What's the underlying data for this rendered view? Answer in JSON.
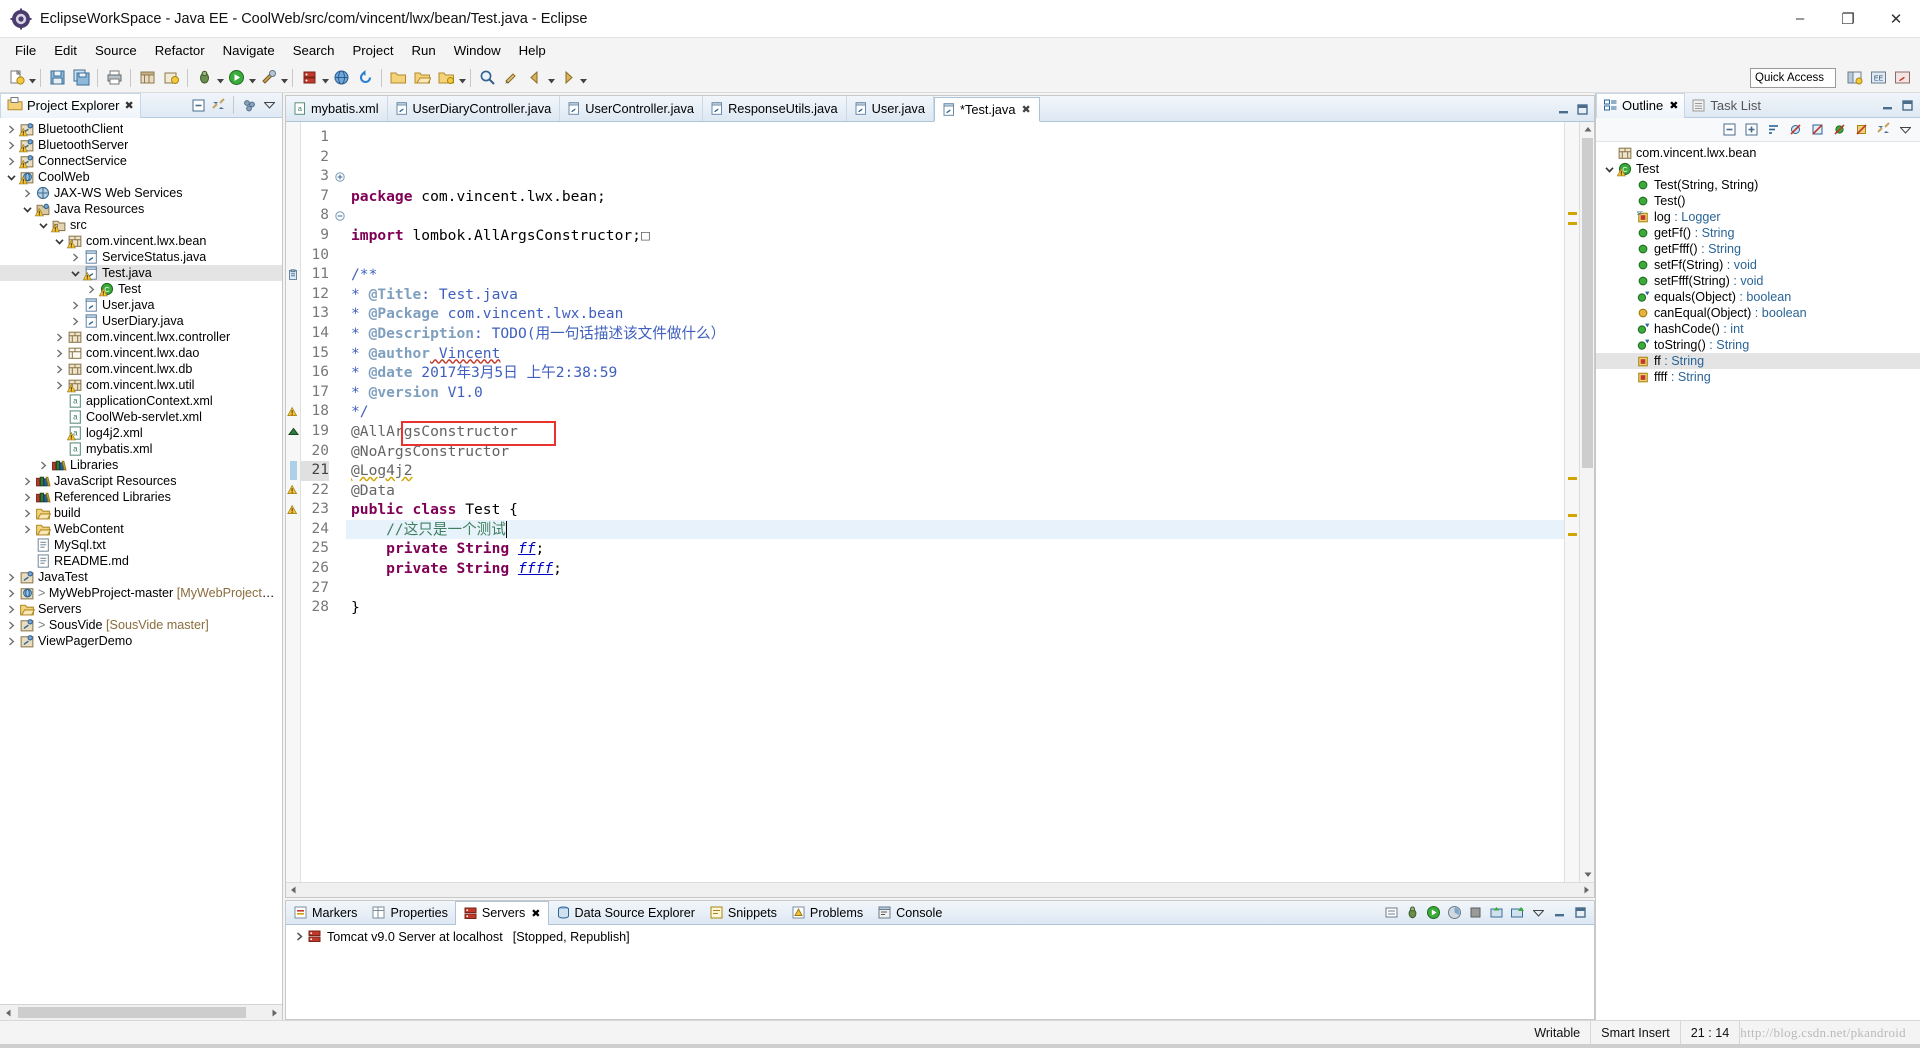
{
  "window": {
    "title": "EclipseWorkSpace - Java EE - CoolWeb/src/com/vincent/lwx/bean/Test.java - Eclipse",
    "icon": "eclipse-icon",
    "minimize": "–",
    "maximize": "❐",
    "close": "✕"
  },
  "menubar": {
    "items": [
      "File",
      "Edit",
      "Source",
      "Refactor",
      "Navigate",
      "Search",
      "Project",
      "Run",
      "Window",
      "Help"
    ]
  },
  "toolbar": {
    "quick_access_placeholder": "Quick Access"
  },
  "project_explorer": {
    "tab_label": "Project Explorer",
    "close_glyph": "✖",
    "tree": [
      {
        "label": "BluetoothClient",
        "indent": 0,
        "twist": "collapsed",
        "icon": "java-project-icon",
        "warn": true
      },
      {
        "label": "BluetoothServer",
        "indent": 0,
        "twist": "collapsed",
        "icon": "java-project-icon",
        "warn": true
      },
      {
        "label": "ConnectService",
        "indent": 0,
        "twist": "collapsed",
        "icon": "java-project-icon",
        "warn": true
      },
      {
        "label": "CoolWeb",
        "indent": 0,
        "twist": "expanded",
        "icon": "web-project-icon",
        "warn": true
      },
      {
        "label": "JAX-WS Web Services",
        "indent": 1,
        "twist": "collapsed",
        "icon": "jaxws-icon",
        "warn": false
      },
      {
        "label": "Java Resources",
        "indent": 1,
        "twist": "expanded",
        "icon": "java-resources-icon",
        "warn": true
      },
      {
        "label": "src",
        "indent": 2,
        "twist": "expanded",
        "icon": "source-folder-icon",
        "warn": true
      },
      {
        "label": "com.vincent.lwx.bean",
        "indent": 3,
        "twist": "expanded",
        "icon": "package-icon",
        "warn": true
      },
      {
        "label": "ServiceStatus.java",
        "indent": 4,
        "twist": "collapsed",
        "icon": "java-file-icon",
        "warn": false
      },
      {
        "label": "Test.java",
        "indent": 4,
        "twist": "expanded",
        "icon": "java-file-icon",
        "warn": true,
        "selected": true
      },
      {
        "label": "Test",
        "indent": 5,
        "twist": "collapsed",
        "icon": "class-icon",
        "warn": true
      },
      {
        "label": "User.java",
        "indent": 4,
        "twist": "collapsed",
        "icon": "java-file-icon",
        "warn": false
      },
      {
        "label": "UserDiary.java",
        "indent": 4,
        "twist": "collapsed",
        "icon": "java-file-icon",
        "warn": false
      },
      {
        "label": "com.vincent.lwx.controller",
        "indent": 3,
        "twist": "collapsed",
        "icon": "package-icon",
        "warn": false
      },
      {
        "label": "com.vincent.lwx.dao",
        "indent": 3,
        "twist": "collapsed",
        "icon": "package-empty-icon",
        "warn": false
      },
      {
        "label": "com.vincent.lwx.db",
        "indent": 3,
        "twist": "collapsed",
        "icon": "package-icon",
        "warn": false
      },
      {
        "label": "com.vincent.lwx.util",
        "indent": 3,
        "twist": "collapsed",
        "icon": "package-icon",
        "warn": true
      },
      {
        "label": "applicationContext.xml",
        "indent": 3,
        "twist": "none",
        "icon": "xml-file-icon",
        "warn": false
      },
      {
        "label": "CoolWeb-servlet.xml",
        "indent": 3,
        "twist": "none",
        "icon": "xml-file-icon",
        "warn": false
      },
      {
        "label": "log4j2.xml",
        "indent": 3,
        "twist": "none",
        "icon": "xml-file-icon",
        "warn": true
      },
      {
        "label": "mybatis.xml",
        "indent": 3,
        "twist": "none",
        "icon": "xml-file-icon",
        "warn": false
      },
      {
        "label": "Libraries",
        "indent": 2,
        "twist": "collapsed",
        "icon": "library-icon",
        "warn": false
      },
      {
        "label": "JavaScript Resources",
        "indent": 1,
        "twist": "collapsed",
        "icon": "library-icon",
        "warn": false
      },
      {
        "label": "Referenced Libraries",
        "indent": 1,
        "twist": "collapsed",
        "icon": "library-icon",
        "warn": false
      },
      {
        "label": "build",
        "indent": 1,
        "twist": "collapsed",
        "icon": "folder-icon",
        "warn": false
      },
      {
        "label": "WebContent",
        "indent": 1,
        "twist": "collapsed",
        "icon": "folder-icon",
        "warn": false
      },
      {
        "label": "MySql.txt",
        "indent": 1,
        "twist": "none",
        "icon": "text-file-icon",
        "warn": false
      },
      {
        "label": "README.md",
        "indent": 1,
        "twist": "none",
        "icon": "text-file-icon",
        "warn": false
      },
      {
        "label": "JavaTest",
        "indent": 0,
        "twist": "collapsed",
        "icon": "java-project-icon",
        "warn": false
      },
      {
        "label": "MyWebProject-master",
        "indent": 0,
        "twist": "collapsed",
        "icon": "web-project-icon",
        "warn": false,
        "decoration": "[MyWebProject-master m",
        "closed": true
      },
      {
        "label": "Servers",
        "indent": 0,
        "twist": "collapsed",
        "icon": "folder-icon",
        "warn": false
      },
      {
        "label": "SousVide",
        "indent": 0,
        "twist": "collapsed",
        "icon": "java-project-icon",
        "warn": false,
        "decoration": "[SousVide master]",
        "closed": true
      },
      {
        "label": "ViewPagerDemo",
        "indent": 0,
        "twist": "collapsed",
        "icon": "java-project-icon",
        "warn": false
      }
    ]
  },
  "editor": {
    "tabs": [
      {
        "label": "mybatis.xml",
        "icon": "xml-file-icon",
        "active": false,
        "dirty": false
      },
      {
        "label": "UserDiaryController.java",
        "icon": "java-file-icon",
        "active": false,
        "dirty": false
      },
      {
        "label": "UserController.java",
        "icon": "java-file-icon",
        "active": false,
        "dirty": false
      },
      {
        "label": "ResponseUtils.java",
        "icon": "java-file-icon",
        "active": false,
        "dirty": false
      },
      {
        "label": "User.java",
        "icon": "java-file-icon",
        "active": false,
        "dirty": false
      },
      {
        "label": "*Test.java",
        "icon": "java-file-icon",
        "active": true,
        "dirty": true
      }
    ],
    "lines": [
      {
        "num": "1",
        "marker": "",
        "fold": "",
        "segs": [
          {
            "t": "package ",
            "c": "kw"
          },
          {
            "t": "com.vincent.lwx.bean;",
            "c": ""
          }
        ]
      },
      {
        "num": "2",
        "marker": "",
        "fold": "",
        "segs": []
      },
      {
        "num": "3",
        "marker": "",
        "fold": "plus",
        "segs": [
          {
            "t": "import ",
            "c": "kw"
          },
          {
            "t": "lombok.AllArgsConstructor;",
            "c": ""
          },
          {
            "t": "□",
            "c": "ann"
          }
        ]
      },
      {
        "num": "7",
        "marker": "",
        "fold": "",
        "segs": []
      },
      {
        "num": "8",
        "marker": "",
        "fold": "minus",
        "segs": [
          {
            "t": "/**",
            "c": "jd"
          }
        ]
      },
      {
        "num": "9",
        "marker": "",
        "fold": "",
        "segs": [
          {
            "t": "* ",
            "c": "jd"
          },
          {
            "t": "@Title",
            "c": "jdt"
          },
          {
            "t": ": Test.java",
            "c": "jd"
          }
        ]
      },
      {
        "num": "10",
        "marker": "",
        "fold": "",
        "segs": [
          {
            "t": "* ",
            "c": "jd"
          },
          {
            "t": "@Package",
            "c": "jdt"
          },
          {
            "t": " com.vincent.lwx.bean",
            "c": "jd"
          }
        ]
      },
      {
        "num": "11",
        "marker": "todo",
        "fold": "",
        "segs": [
          {
            "t": "* ",
            "c": "jd"
          },
          {
            "t": "@Description",
            "c": "jdt"
          },
          {
            "t": ": TODO(用一句话描述该文件做什么）",
            "c": "jd"
          }
        ]
      },
      {
        "num": "12",
        "marker": "",
        "fold": "",
        "segs": [
          {
            "t": "* ",
            "c": "jd"
          },
          {
            "t": "@author",
            "c": "jdt"
          },
          {
            "t": " Vincent",
            "c": "jd spell"
          }
        ]
      },
      {
        "num": "13",
        "marker": "",
        "fold": "",
        "segs": [
          {
            "t": "* ",
            "c": "jd"
          },
          {
            "t": "@date",
            "c": "jdt"
          },
          {
            "t": " 2017年3月5日 上午2:38:59",
            "c": "jd"
          }
        ]
      },
      {
        "num": "14",
        "marker": "",
        "fold": "",
        "segs": [
          {
            "t": "* ",
            "c": "jd"
          },
          {
            "t": "@version",
            "c": "jdt"
          },
          {
            "t": " V1.0",
            "c": "jd"
          }
        ]
      },
      {
        "num": "15",
        "marker": "",
        "fold": "",
        "segs": [
          {
            "t": "*/",
            "c": "jd"
          }
        ]
      },
      {
        "num": "16",
        "marker": "",
        "fold": "",
        "segs": [
          {
            "t": "@AllArgsConstructor",
            "c": "ann"
          }
        ]
      },
      {
        "num": "17",
        "marker": "",
        "fold": "",
        "segs": [
          {
            "t": "@NoArgsConstructor",
            "c": "ann"
          }
        ]
      },
      {
        "num": "18",
        "marker": "warn",
        "fold": "",
        "segs": [
          {
            "t": "@Log4j2",
            "c": "ann spell"
          }
        ]
      },
      {
        "num": "19",
        "marker": "override",
        "fold": "",
        "segs": [
          {
            "t": "@Data",
            "c": "ann"
          }
        ]
      },
      {
        "num": "20",
        "marker": "",
        "fold": "",
        "segs": [
          {
            "t": "public class ",
            "c": "kw"
          },
          {
            "t": "Test {",
            "c": ""
          }
        ]
      },
      {
        "num": "21",
        "marker": "change",
        "fold": "",
        "highlight": true,
        "segs": [
          {
            "t": "    //这只是一个测试",
            "c": "cm"
          }
        ]
      },
      {
        "num": "22",
        "marker": "warn",
        "fold": "",
        "segs": [
          {
            "t": "    ",
            "c": ""
          },
          {
            "t": "private String ",
            "c": "kw"
          },
          {
            "t": "ff",
            "c": "fld"
          },
          {
            "t": ";",
            "c": ""
          }
        ]
      },
      {
        "num": "23",
        "marker": "warn",
        "fold": "",
        "segs": [
          {
            "t": "    ",
            "c": ""
          },
          {
            "t": "private String ",
            "c": "kw"
          },
          {
            "t": "ffff",
            "c": "fld"
          },
          {
            "t": ";",
            "c": ""
          }
        ]
      },
      {
        "num": "24",
        "marker": "",
        "fold": "",
        "segs": []
      },
      {
        "num": "25",
        "marker": "",
        "fold": "",
        "segs": [
          {
            "t": "}",
            "c": ""
          }
        ]
      },
      {
        "num": "26",
        "marker": "",
        "fold": "",
        "segs": []
      },
      {
        "num": "27",
        "marker": "",
        "fold": "",
        "segs": []
      },
      {
        "num": "28",
        "marker": "",
        "fold": "",
        "segs": []
      }
    ],
    "annotation_color": "#e8332f"
  },
  "bottom_panel": {
    "tabs": [
      {
        "label": "Markers",
        "icon": "markers-icon",
        "active": false
      },
      {
        "label": "Properties",
        "icon": "properties-icon",
        "active": false
      },
      {
        "label": "Servers",
        "icon": "servers-icon",
        "active": true,
        "close_glyph": "✖"
      },
      {
        "label": "Data Source Explorer",
        "icon": "datasource-icon",
        "active": false
      },
      {
        "label": "Snippets",
        "icon": "snippets-icon",
        "active": false
      },
      {
        "label": "Problems",
        "icon": "problems-icon",
        "active": false
      },
      {
        "label": "Console",
        "icon": "console-icon",
        "active": false
      }
    ],
    "server_row": {
      "name": "Tomcat v9.0 Server at localhost",
      "state": "[Stopped, Republish]"
    }
  },
  "outline": {
    "tabs": [
      {
        "label": "Outline",
        "icon": "outline-icon",
        "active": true,
        "close_glyph": "✖"
      },
      {
        "label": "Task List",
        "icon": "tasklist-icon",
        "active": false
      }
    ],
    "items": [
      {
        "label": "com.vincent.lwx.bean",
        "type": "",
        "indent": 0,
        "twist": "none",
        "icon": "package-icon",
        "vis": ""
      },
      {
        "label": "Test",
        "type": "",
        "indent": 0,
        "twist": "expanded",
        "icon": "class-icon",
        "vis": "",
        "warn": true
      },
      {
        "label": "Test(String, String)",
        "type": "",
        "indent": 1,
        "twist": "none",
        "icon": "method-icon",
        "vis": "public"
      },
      {
        "label": "Test()",
        "type": "",
        "indent": 1,
        "twist": "none",
        "icon": "method-icon",
        "vis": "public"
      },
      {
        "label": "log",
        "type": " : Logger",
        "indent": 1,
        "twist": "none",
        "icon": "field-static-final-icon",
        "vis": "private"
      },
      {
        "label": "getFf()",
        "type": " : String",
        "indent": 1,
        "twist": "none",
        "icon": "method-icon",
        "vis": "public"
      },
      {
        "label": "getFfff()",
        "type": " : String",
        "indent": 1,
        "twist": "none",
        "icon": "method-icon",
        "vis": "public"
      },
      {
        "label": "setFf(String)",
        "type": " : void",
        "indent": 1,
        "twist": "none",
        "icon": "method-icon",
        "vis": "public"
      },
      {
        "label": "setFfff(String)",
        "type": " : void",
        "indent": 1,
        "twist": "none",
        "icon": "method-icon",
        "vis": "public"
      },
      {
        "label": "equals(Object)",
        "type": " : boolean",
        "indent": 1,
        "twist": "none",
        "icon": "method-override-icon",
        "vis": "public"
      },
      {
        "label": "canEqual(Object)",
        "type": " : boolean",
        "indent": 1,
        "twist": "none",
        "icon": "method-protected-icon",
        "vis": "protected"
      },
      {
        "label": "hashCode()",
        "type": " : int",
        "indent": 1,
        "twist": "none",
        "icon": "method-override-icon",
        "vis": "public"
      },
      {
        "label": "toString()",
        "type": " : String",
        "indent": 1,
        "twist": "none",
        "icon": "method-override-icon",
        "vis": "public"
      },
      {
        "label": "ff",
        "type": " : String",
        "indent": 1,
        "twist": "none",
        "icon": "field-private-icon",
        "vis": "private",
        "selected": true
      },
      {
        "label": "ffff",
        "type": " : String",
        "indent": 1,
        "twist": "none",
        "icon": "field-private-icon",
        "vis": "private"
      }
    ]
  },
  "statusbar": {
    "writable": "Writable",
    "insert_mode": "Smart Insert",
    "position": "21 : 14",
    "watermark": "http://blog.csdn.net/pkandroid"
  }
}
